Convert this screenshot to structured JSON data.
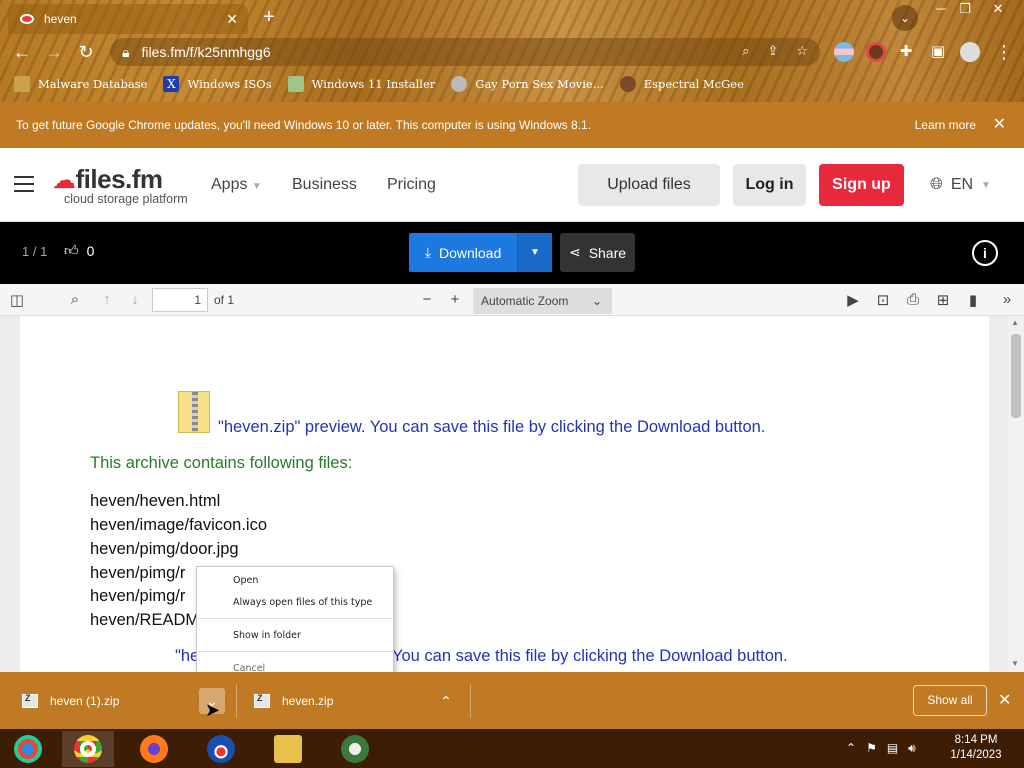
{
  "browser": {
    "tab_title": "heven",
    "url": "files.fm/f/k25nmhgg6",
    "bookmarks": [
      {
        "label": "Malware Database",
        "icon": "folder-icon"
      },
      {
        "label": "Windows ISOs",
        "icon": "x-icon"
      },
      {
        "label": "Windows 11 Installer",
        "icon": "image-icon"
      },
      {
        "label": "Gay Porn Sex Movie...",
        "icon": "site-icon"
      },
      {
        "label": "Espectral McGee",
        "icon": "site-icon"
      }
    ]
  },
  "infobar": {
    "message": "To get future Google Chrome updates, you'll need Windows 10 or later. This computer is using Windows 8.1.",
    "learn_more": "Learn more"
  },
  "site": {
    "logo_name": "files.fm",
    "logo_tagline": "cloud storage platform",
    "nav": [
      "Apps",
      "Business",
      "Pricing"
    ],
    "upload": "Upload files",
    "login": "Log in",
    "signup": "Sign up",
    "lang": "EN"
  },
  "viewer": {
    "counter": "1 / 1",
    "likes": "0",
    "download": "Download",
    "share": "Share"
  },
  "pdf": {
    "page": "1",
    "of": "of 1",
    "zoom": "Automatic Zoom"
  },
  "document": {
    "preview_text": "\"heven.zip\" preview. You can save this file by clicking the Download button.",
    "contains": "This archive contains following files:",
    "files": [
      "heven/heven.html",
      "heven/image/favicon.ico",
      "heven/pimg/door.jpg",
      "heven/pimg/r",
      "heven/pimg/r",
      "heven/READM"
    ],
    "bottom_preview_left": "\"he",
    "bottom_preview_right": "You can save this file by clicking the Download button."
  },
  "context_menu": {
    "items": [
      "Open",
      "Always open files of this type",
      "Show in folder",
      "Cancel"
    ]
  },
  "downloads": {
    "items": [
      "heven (1).zip",
      "heven.zip"
    ],
    "show_all": "Show all"
  },
  "taskbar": {
    "time": "8:14 PM",
    "date": "1/14/2023"
  }
}
